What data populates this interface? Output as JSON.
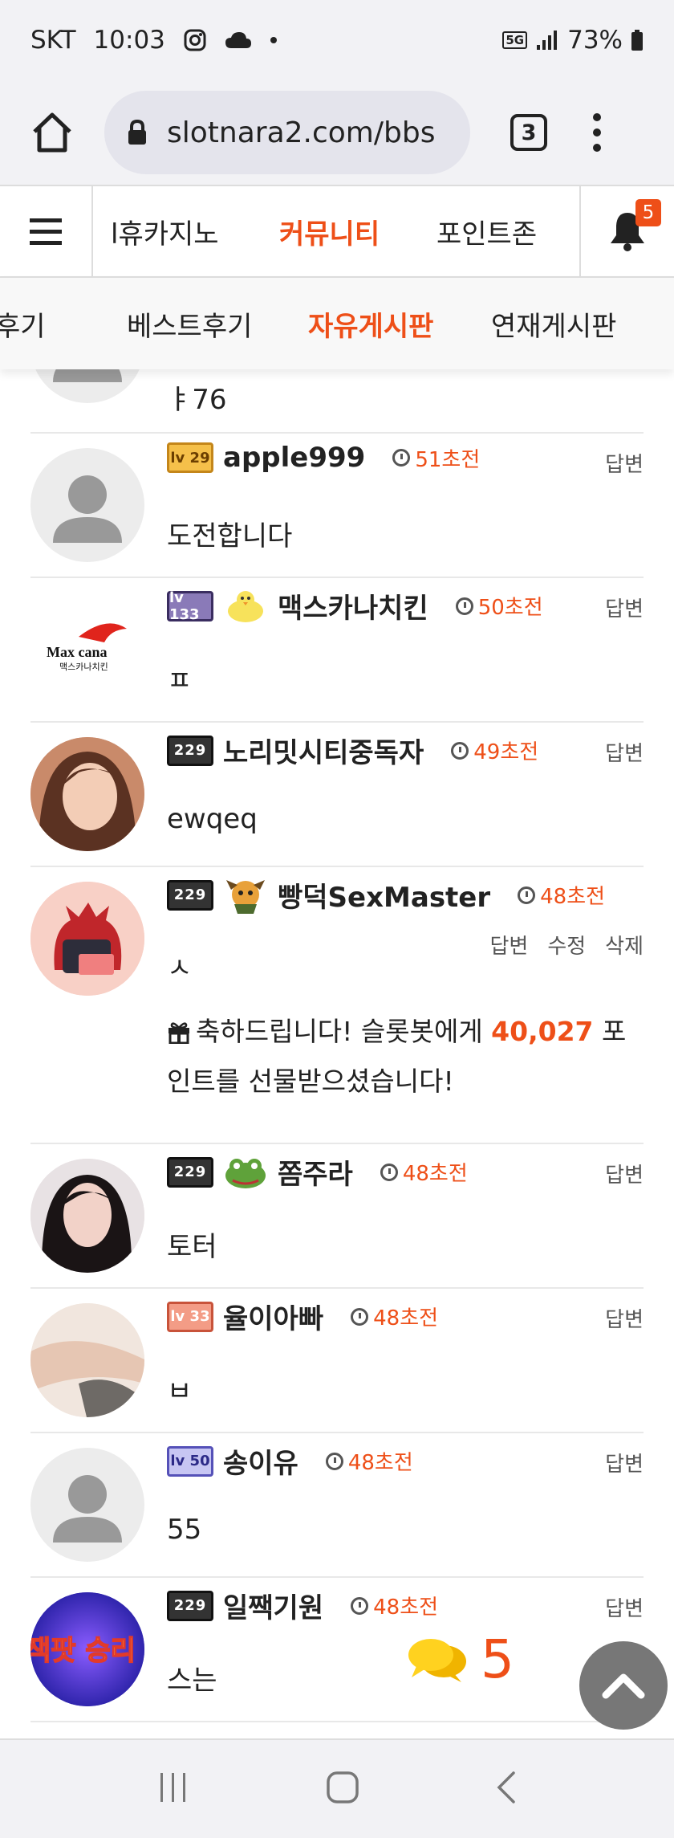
{
  "status_bar": {
    "carrier": "SKT",
    "time": "10:03",
    "network": "5G",
    "battery": "73%"
  },
  "browser": {
    "url": "slotnara2.com/bbs",
    "tab_count": "3"
  },
  "nav": {
    "items": [
      "l휴카지노",
      "커뮤니티",
      "포인트존"
    ],
    "active": "커뮤니티",
    "notification_count": "5"
  },
  "subnav": {
    "items": [
      "후기",
      "베스트후기",
      "자유게시판",
      "연재게시판"
    ],
    "active": "자유게시판"
  },
  "comments": [
    {
      "nick": "",
      "time": "",
      "text": "ㅑ76",
      "actions": []
    },
    {
      "nick": "apple999",
      "level": "lv 29",
      "time": "51초전",
      "text": "도전합니다",
      "actions": [
        "답변"
      ]
    },
    {
      "nick": "맥스카나치킨",
      "level": "lv 133",
      "time": "50초전",
      "text": "ㅍ",
      "actions": [
        "답변"
      ],
      "avatar_text": "Max cana 맥스카나치킨"
    },
    {
      "nick": "노리밋시티중독자",
      "level": "229",
      "time": "49초전",
      "text": "ewqeq",
      "actions": [
        "답변"
      ]
    },
    {
      "nick": "빵덕SexMaster",
      "level": "229",
      "time": "48초전",
      "text": "ㅅ",
      "actions": [
        "답변",
        "수정",
        "삭제"
      ],
      "gift_pre": "축하드립니다! 슬롯봇에게 ",
      "gift_points": "40,027",
      "gift_post": " 포인트를 선물받으셨습니다!"
    },
    {
      "nick": "쫌주라",
      "level": "229",
      "time": "48초전",
      "text": "토터",
      "actions": [
        "답변"
      ]
    },
    {
      "nick": "율이아빠",
      "level": "lv 33",
      "time": "48초전",
      "text": "ㅂ",
      "actions": [
        "답변"
      ]
    },
    {
      "nick": "송이유",
      "level": "lv 50",
      "time": "48초전",
      "text": "55",
      "actions": [
        "답변"
      ]
    },
    {
      "nick": "일짹기원",
      "level": "229",
      "time": "48초전",
      "text": "스는",
      "actions": [
        "답변"
      ],
      "avatar_text": "잭팟 승리"
    }
  ],
  "chat_count": "5",
  "colors": {
    "accent": "#ee4f18",
    "background": "#f2f2f5"
  }
}
